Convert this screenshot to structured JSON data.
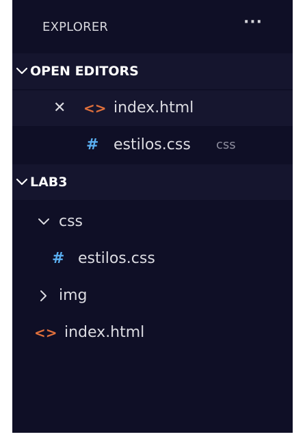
{
  "explorer": {
    "title": "EXPLORER",
    "more_icon": "···"
  },
  "open_editors": {
    "label": "OPEN EDITORS",
    "items": [
      {
        "icon": "html-icon",
        "name": "index.html",
        "close_glyph": "✕",
        "active": true
      },
      {
        "icon": "css-icon",
        "name": "estilos.css",
        "description": "css"
      }
    ]
  },
  "workspace": {
    "label": "LAB3",
    "tree": {
      "css_folder": "css",
      "css_file": "estilos.css",
      "img_folder": "img",
      "index_file": "index.html"
    }
  },
  "glyphs": {
    "html": "<>",
    "css": "#"
  },
  "colors": {
    "panel_bg": "#0f0f26",
    "header_bg": "#15152e",
    "html_icon": "#e0703c",
    "css_icon": "#5aaef0"
  }
}
